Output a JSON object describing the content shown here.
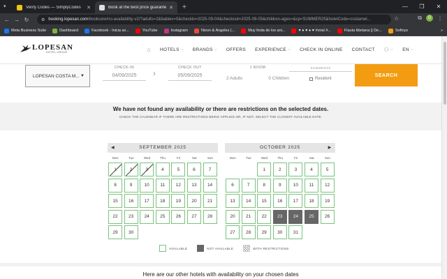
{
  "browser": {
    "tabs": [
      {
        "title": "Verify Codes — SimplyCodes",
        "favicon_color": "#f1c40f",
        "active": false
      },
      {
        "title": "Book at the best price guarante",
        "favicon_color": "#e0e0e0",
        "active": true
      }
    ],
    "new_tab": "+",
    "url_host": "booking.lopesan.com",
    "url_path": "/bookcore/no-availability-v2/?adults=2&babies=0&checkin=2025-09-04&checkout=2025-09-05&children-ages=&cp=SUMMER25&hotelCode=costamel...",
    "profile_initial": "G",
    "bookmarks": [
      {
        "label": "Meta Business Suite",
        "color": "#1877f2"
      },
      {
        "label": "Dashboard",
        "color": "#7cb342"
      },
      {
        "label": "Facebook - Inicia se...",
        "color": "#1877f2"
      },
      {
        "label": "YouTube",
        "color": "#ff0000"
      },
      {
        "label": "Instagram",
        "color": "#c13584"
      },
      {
        "label": "Nixon & Angeles (...",
        "color": "#e74c3c"
      },
      {
        "label": "Muy linda de los ani...",
        "color": "#ff0000"
      },
      {
        "label": "♥ ● ♥ ● ♥ #viral #...",
        "color": "#ff0000"
      },
      {
        "label": "Flauta tibetana || De...",
        "color": "#ff0000"
      },
      {
        "label": "Softnyx",
        "color": "#f39c12"
      }
    ],
    "all_bookmarks": "»"
  },
  "header": {
    "brand": "LOPESAN",
    "brand_sub": "HOTEL GROUP",
    "nav": [
      {
        "label": "HOTELS",
        "dropdown": true
      },
      {
        "label": "BRANDS",
        "dropdown": true
      },
      {
        "label": "OFFERS",
        "dropdown": false
      },
      {
        "label": "EXPERIENCE",
        "dropdown": true
      },
      {
        "label": "CHECK IN ONLINE",
        "dropdown": false
      },
      {
        "label": "CONTACT",
        "dropdown": false
      }
    ],
    "language": "EN"
  },
  "search": {
    "hotel": "LOPESAN COSTA M...",
    "checkin_label": "CHECK-IN",
    "checkin_value": "04/09/2025",
    "checkout_label": "CHECK OUT",
    "checkout_value": "05/09/2025",
    "room_label": "1 ROOM",
    "adults": "2 Adults",
    "children": "0 Children",
    "promo_value": "SUMMER25",
    "resident_label": "Resident",
    "button": "SEARCH"
  },
  "notice": {
    "heading": "We have not found any availability or there are restrictions on the selected dates.",
    "subtext": "CHECK THE CALENDAR IF THERE ARE RESTRICTIONS BEING APPLIED OR, IF NOT, SELECT THE CLOSEST AVAILABLE DATE."
  },
  "calendar": {
    "weekdays": [
      "Mon",
      "Tue",
      "Wed",
      "Thu",
      "Fri",
      "Sat",
      "Sun"
    ],
    "months": [
      {
        "title": "SEPTEMBER 2025",
        "offset": 0,
        "days": 30,
        "restricted": [
          1,
          2,
          3
        ],
        "not_available": [],
        "prev_arrow": true,
        "next_arrow": false
      },
      {
        "title": "OCTOBER 2025",
        "offset": 2,
        "days": 31,
        "restricted": [],
        "not_available": [
          23,
          24,
          25
        ],
        "prev_arrow": false,
        "next_arrow": true
      }
    ],
    "legend": {
      "available": "AVAILABLE",
      "not_available": "NOT AVAILABLE",
      "restricted": "WITH RESTRICTIONS"
    }
  },
  "other_hotels": "Here are our other hotels with availability on your chosen dates"
}
